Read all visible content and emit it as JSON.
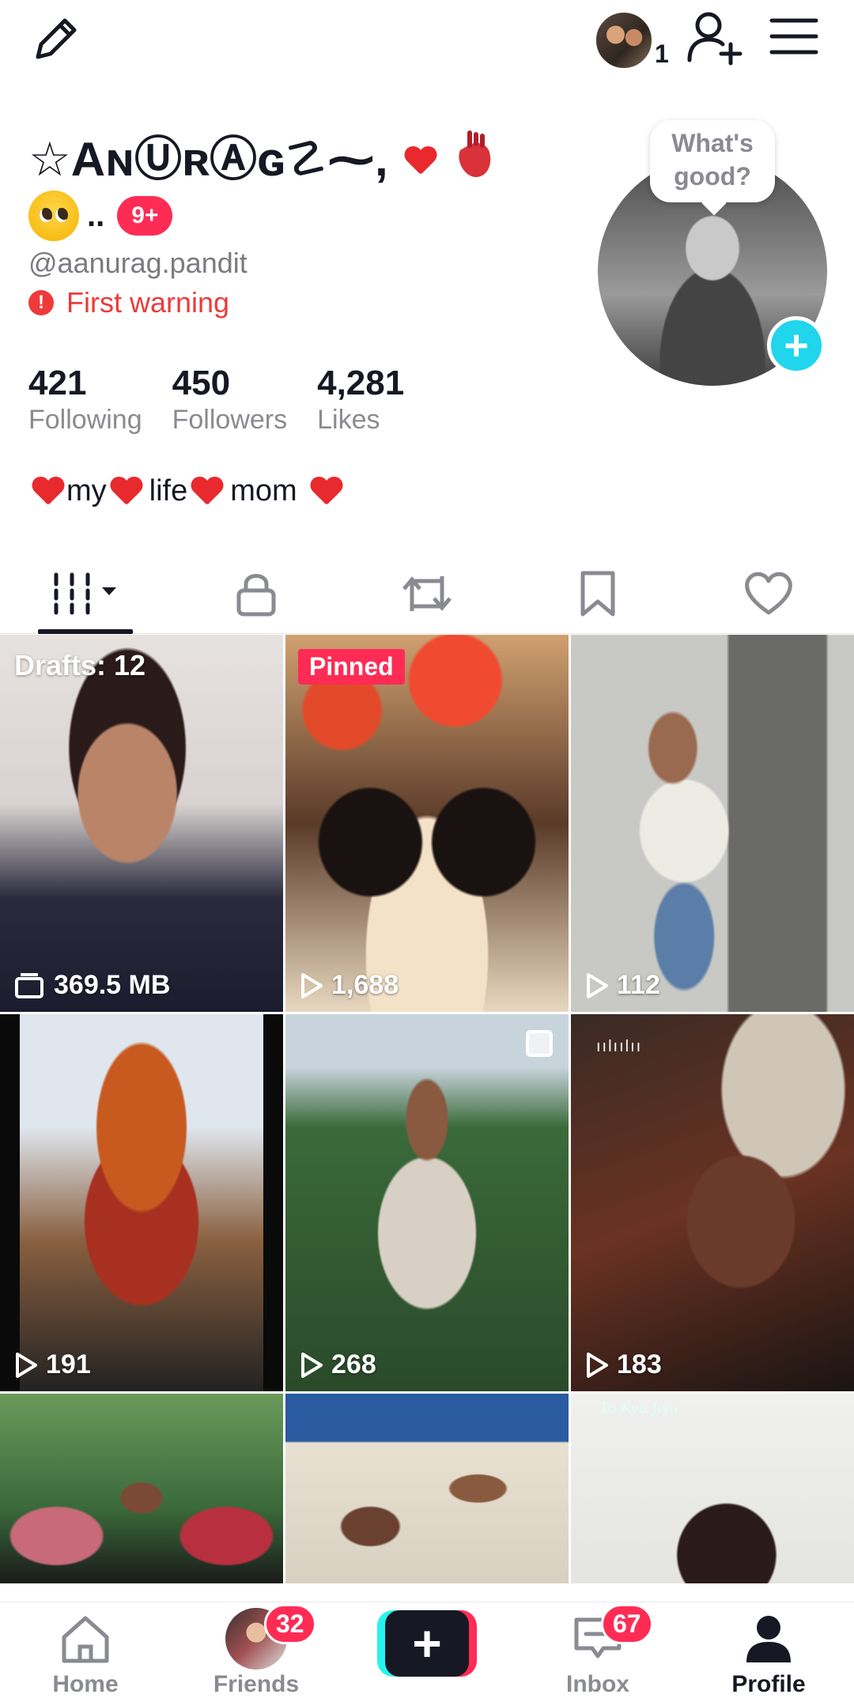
{
  "header": {
    "follower_request_count": "1"
  },
  "profile": {
    "display_name": "☆AɴⓊʀⒶɢ☡⁓,",
    "unread_badge": "9+",
    "dots": "..",
    "username": "@aanurag.pandit",
    "warning": "First warning",
    "status_prompt_line1": "What's",
    "status_prompt_line2": "good?",
    "stats": [
      {
        "value": "421",
        "label": "Following"
      },
      {
        "value": "450",
        "label": "Followers"
      },
      {
        "value": "4,281",
        "label": "Likes"
      }
    ],
    "bio_words": [
      "my",
      "life",
      "mom"
    ]
  },
  "tabs": [
    {
      "name": "videos",
      "icon": "grid-icon",
      "active": true
    },
    {
      "name": "private",
      "icon": "lock-icon",
      "active": false
    },
    {
      "name": "reposts",
      "icon": "repost-icon",
      "active": false
    },
    {
      "name": "favorites",
      "icon": "bookmark-icon",
      "active": false
    },
    {
      "name": "liked",
      "icon": "heart-icon",
      "active": false
    }
  ],
  "grid": {
    "drafts_label": "Drafts: 12",
    "drafts_size": "369.5 MB",
    "pinned_label": "Pinned",
    "views": [
      "1,688",
      "112",
      "191",
      "268",
      "183"
    ],
    "caption_snippet": "To Kya Jiya"
  },
  "bottom_nav": [
    {
      "label": "Home",
      "badge": null
    },
    {
      "label": "Friends",
      "badge": "32"
    },
    {
      "label": "",
      "badge": null
    },
    {
      "label": "Inbox",
      "badge": "67"
    },
    {
      "label": "Profile",
      "badge": null
    }
  ],
  "colors": {
    "accent_red": "#fe2c55",
    "accent_cyan": "#20d5ec",
    "warning_red": "#ee3a3a",
    "text_primary": "#161823",
    "text_secondary": "#8a8b91"
  }
}
